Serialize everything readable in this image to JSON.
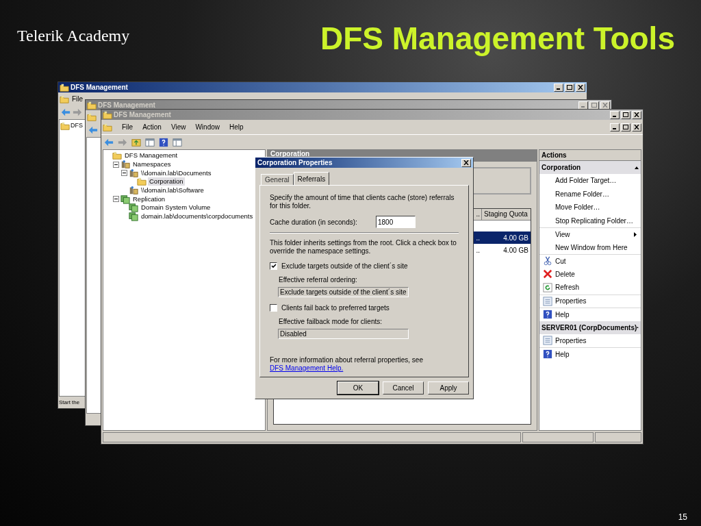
{
  "slide": {
    "logo": "Telerik Academy",
    "title": "DFS Management Tools",
    "page_number": "15"
  },
  "back_windows": [
    {
      "title": "DFS Management",
      "active": true,
      "menu": [
        "File"
      ],
      "tree": [
        "DFS"
      ],
      "status": "Start the"
    },
    {
      "title": "DFS Management",
      "active": false
    }
  ],
  "window": {
    "title": "DFS Management",
    "active": false,
    "menu": [
      "File",
      "Action",
      "View",
      "Window",
      "Help"
    ],
    "tree": [
      {
        "label": "DFS Management",
        "kind": "root",
        "selected": false,
        "children": [
          {
            "label": "Namespaces",
            "kind": "namespaces",
            "expanded": true,
            "selected": false,
            "children": [
              {
                "label": "\\\\domain.lab\\Documents",
                "kind": "namespace",
                "expanded": true,
                "selected": false,
                "children": [
                  {
                    "label": "Corporation",
                    "kind": "folder",
                    "selected": true
                  }
                ]
              },
              {
                "label": "\\\\domain.lab\\Software",
                "kind": "namespace",
                "selected": false
              }
            ]
          },
          {
            "label": "Replication",
            "kind": "replication",
            "expanded": true,
            "selected": false,
            "children": [
              {
                "label": "Domain System Volume",
                "kind": "group",
                "selected": false
              },
              {
                "label": "domain.lab\\documents\\corpdocuments",
                "kind": "group",
                "selected": false
              }
            ]
          }
        ]
      }
    ],
    "middle": {
      "header": "Corporation",
      "columns": [
        "..",
        "Staging Quota"
      ],
      "rows": [
        {
          "cells": [
            "..",
            "4.00 GB"
          ],
          "selected": true
        },
        {
          "cells": [
            "..",
            "4.00 GB"
          ],
          "selected": false
        }
      ]
    },
    "actions": {
      "title": "Actions",
      "groups": [
        {
          "title": "Corporation",
          "expanded": true,
          "items": [
            {
              "label": "Add Folder Target…",
              "kind": "none",
              "separator": false,
              "submenu": false
            },
            {
              "label": "Rename Folder…",
              "kind": "none",
              "separator": false,
              "submenu": false
            },
            {
              "label": "Move Folder…",
              "kind": "none",
              "separator": false,
              "submenu": false
            },
            {
              "label": "Stop Replicating Folder…",
              "kind": "none",
              "separator": false,
              "submenu": false
            },
            {
              "label": "View",
              "kind": "none",
              "separator": true,
              "submenu": true
            },
            {
              "label": "New Window from Here",
              "kind": "none",
              "separator": false,
              "submenu": false
            },
            {
              "label": "Cut",
              "kind": "cut",
              "separator": true,
              "submenu": false
            },
            {
              "label": "Delete",
              "kind": "delete",
              "separator": false,
              "submenu": false
            },
            {
              "label": "Refresh",
              "kind": "refresh",
              "separator": false,
              "submenu": false
            },
            {
              "label": "Properties",
              "kind": "properties",
              "separator": true,
              "submenu": false
            },
            {
              "label": "Help",
              "kind": "help",
              "separator": true,
              "submenu": false
            }
          ]
        },
        {
          "title": "SERVER01 (CorpDocuments)",
          "expanded": true,
          "items": [
            {
              "label": "Properties",
              "kind": "properties",
              "separator": false,
              "submenu": false
            },
            {
              "label": "Help",
              "kind": "help",
              "separator": true,
              "submenu": false
            }
          ]
        }
      ]
    }
  },
  "dialog": {
    "title": "Corporation Properties",
    "tabs": [
      {
        "label": "General",
        "selected": false
      },
      {
        "label": "Referrals",
        "selected": true
      }
    ],
    "intro": "Specify the amount of time that clients cache (store) referrals for this folder.",
    "cache_label": "Cache duration (in seconds):",
    "cache_value": "1800",
    "inherit_note": "This folder inherits settings from the root. Click a check box to override the namespace settings.",
    "options": [
      {
        "label": "Exclude targets outside of the client´s site",
        "checked": true,
        "sub_label": "Effective referral ordering:",
        "sub_value": "Exclude targets outside of the client´s site"
      },
      {
        "label": "Clients fail back to preferred targets",
        "checked": false,
        "sub_label": "Effective failback mode for clients:",
        "sub_value": "Disabled"
      }
    ],
    "help_text": "For more information about referral properties, see",
    "help_link": "DFS Management Help.",
    "buttons": [
      {
        "label": "OK",
        "default": true
      },
      {
        "label": "Cancel",
        "default": false
      },
      {
        "label": "Apply",
        "default": false
      }
    ]
  }
}
